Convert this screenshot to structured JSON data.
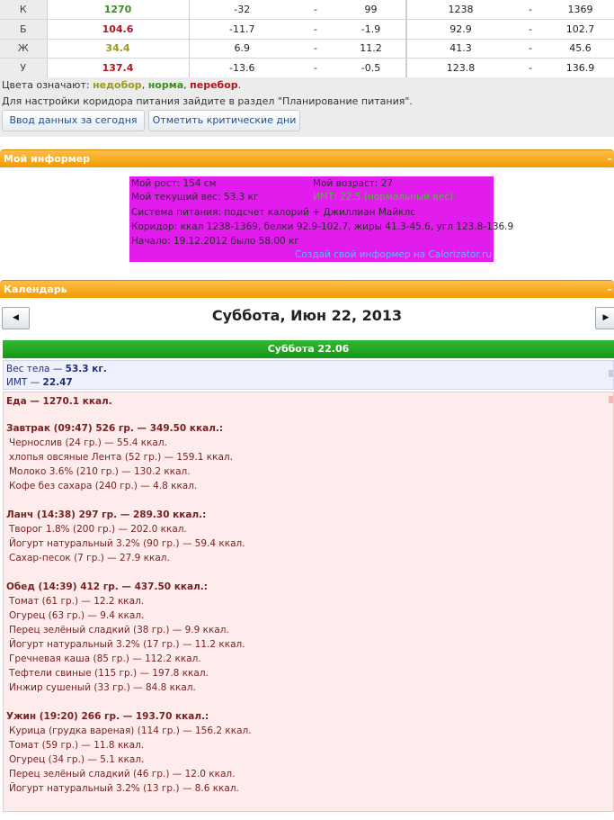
{
  "nutrients": {
    "rows": [
      {
        "label": "К",
        "value": "1270",
        "color": "#3a8d1f",
        "diff_min": "-32",
        "diff_sep": "-",
        "diff_max": "99",
        "range_min": "1238",
        "range_sep": "-",
        "range_max": "1369"
      },
      {
        "label": "Б",
        "value": "104.6",
        "color": "#b1151e",
        "diff_min": "-11.7",
        "diff_sep": "-",
        "diff_max": "-1.9",
        "range_min": "92.9",
        "range_sep": "-",
        "range_max": "102.7"
      },
      {
        "label": "Ж",
        "value": "34.4",
        "color": "#9a9a1a",
        "diff_min": "6.9",
        "diff_sep": "-",
        "diff_max": "11.2",
        "range_min": "41.3",
        "range_sep": "-",
        "range_max": "45.6"
      },
      {
        "label": "У",
        "value": "137.4",
        "color": "#b1151e",
        "diff_min": "-13.6",
        "diff_sep": "-",
        "diff_max": "-0.5",
        "range_min": "123.8",
        "range_sep": "-",
        "range_max": "136.9"
      }
    ]
  },
  "legend": {
    "prefix": "Цвета означают:",
    "under": "недобор",
    "norm": "норма",
    "over": "перебор",
    "under_color": "#9a9a1a",
    "norm_color": "#3a8d1f",
    "over_color": "#b1151e",
    "hint": "Для настройки коридора питания зайдите в раздел \"Планирование питания\"."
  },
  "buttons": {
    "enter_today": "Ввод данных за сегодня",
    "critical_days": "Отметить критические дни"
  },
  "informer": {
    "header": "Мой информер",
    "collapse": "–",
    "height": "Мой рост: 154 см",
    "age": "Мой возраст: 27",
    "weight": "Мой текущий вес: 53.3 кг",
    "bmi": "ИМТ: 22.5 (нормальный вес)",
    "system": "Система питания: подсчет калорий + Джиллиан Майклс",
    "corridor": "Коридор: ккал 1238-1369, белки 92.9-102.7, жиры 41.3-45.6, угл 123.8-136.9",
    "start": "Начало: 19.12.2012 было 58.00 кг",
    "link": "Создай свой информер на Calorizator.ru"
  },
  "calendar": {
    "header": "Календарь",
    "collapse": "–",
    "prev_icon": "◀",
    "next_icon": "▶",
    "date": "Суббота, Июн 22, 2013",
    "day_header": "Суббота 22.06",
    "weight_prefix": "Вес тела — ",
    "weight_value": "53.3 кг.",
    "bmi_prefix": "ИМТ — ",
    "bmi_value": "22.47"
  },
  "food": {
    "total": "Еда — 1270.1 ккал.",
    "lines": [
      {
        "type": "meal",
        "text": "Завтрак (09:47) 526 гр. — 349.50 ккал.:"
      },
      {
        "type": "item",
        "text": "Чернослив (24 гр.) — 55.4 ккал."
      },
      {
        "type": "item",
        "text": "хлопья овсяные Лента (52 гр.) — 159.1 ккал."
      },
      {
        "type": "item",
        "text": "Молоко 3.6% (210 гр.) — 130.2 ккал."
      },
      {
        "type": "item",
        "text": "Кофе без сахара (240 гр.) — 4.8 ккал."
      },
      {
        "type": "gap",
        "text": ""
      },
      {
        "type": "meal",
        "text": "Ланч (14:38) 297 гр. — 289.30 ккал.:"
      },
      {
        "type": "item",
        "text": "Творог 1.8% (200 гр.) — 202.0 ккал."
      },
      {
        "type": "item",
        "text": "Йогурт натуральный 3.2% (90 гр.) — 59.4 ккал."
      },
      {
        "type": "item",
        "text": "Сахар-песок (7 гр.) — 27.9 ккал."
      },
      {
        "type": "gap",
        "text": ""
      },
      {
        "type": "meal",
        "text": "Обед (14:39) 412 гр. — 437.50 ккал.:"
      },
      {
        "type": "item",
        "text": "Томат (61 гр.) — 12.2 ккал."
      },
      {
        "type": "item",
        "text": "Огурец (63 гр.) — 9.4 ккал."
      },
      {
        "type": "item",
        "text": "Перец зелёный сладкий (38 гр.) — 9.9 ккал."
      },
      {
        "type": "item",
        "text": "Йогурт натуральный 3.2% (17 гр.) — 11.2 ккал."
      },
      {
        "type": "item",
        "text": "Гречневая каша (85 гр.) — 112.2 ккал."
      },
      {
        "type": "item",
        "text": "Тефтели свиные (115 гр.) — 197.8 ккал."
      },
      {
        "type": "item",
        "text": "Инжир сушеный (33 гр.) — 84.8 ккал."
      },
      {
        "type": "gap",
        "text": ""
      },
      {
        "type": "meal",
        "text": "Ужин (19:20) 266 гр. — 193.70 ккал.:"
      },
      {
        "type": "item",
        "text": "Курица (грудка вареная) (114 гр.) — 156.2 ккал."
      },
      {
        "type": "item",
        "text": "Томат (59 гр.) — 11.8 ккал."
      },
      {
        "type": "item",
        "text": "Огурец (34 гр.) — 5.1 ккал."
      },
      {
        "type": "item",
        "text": "Перец зелёный сладкий (46 гр.) — 12.0 ккал."
      },
      {
        "type": "item",
        "text": "Йогурт натуральный 3.2% (13 гр.) — 8.6 ккал."
      }
    ]
  }
}
